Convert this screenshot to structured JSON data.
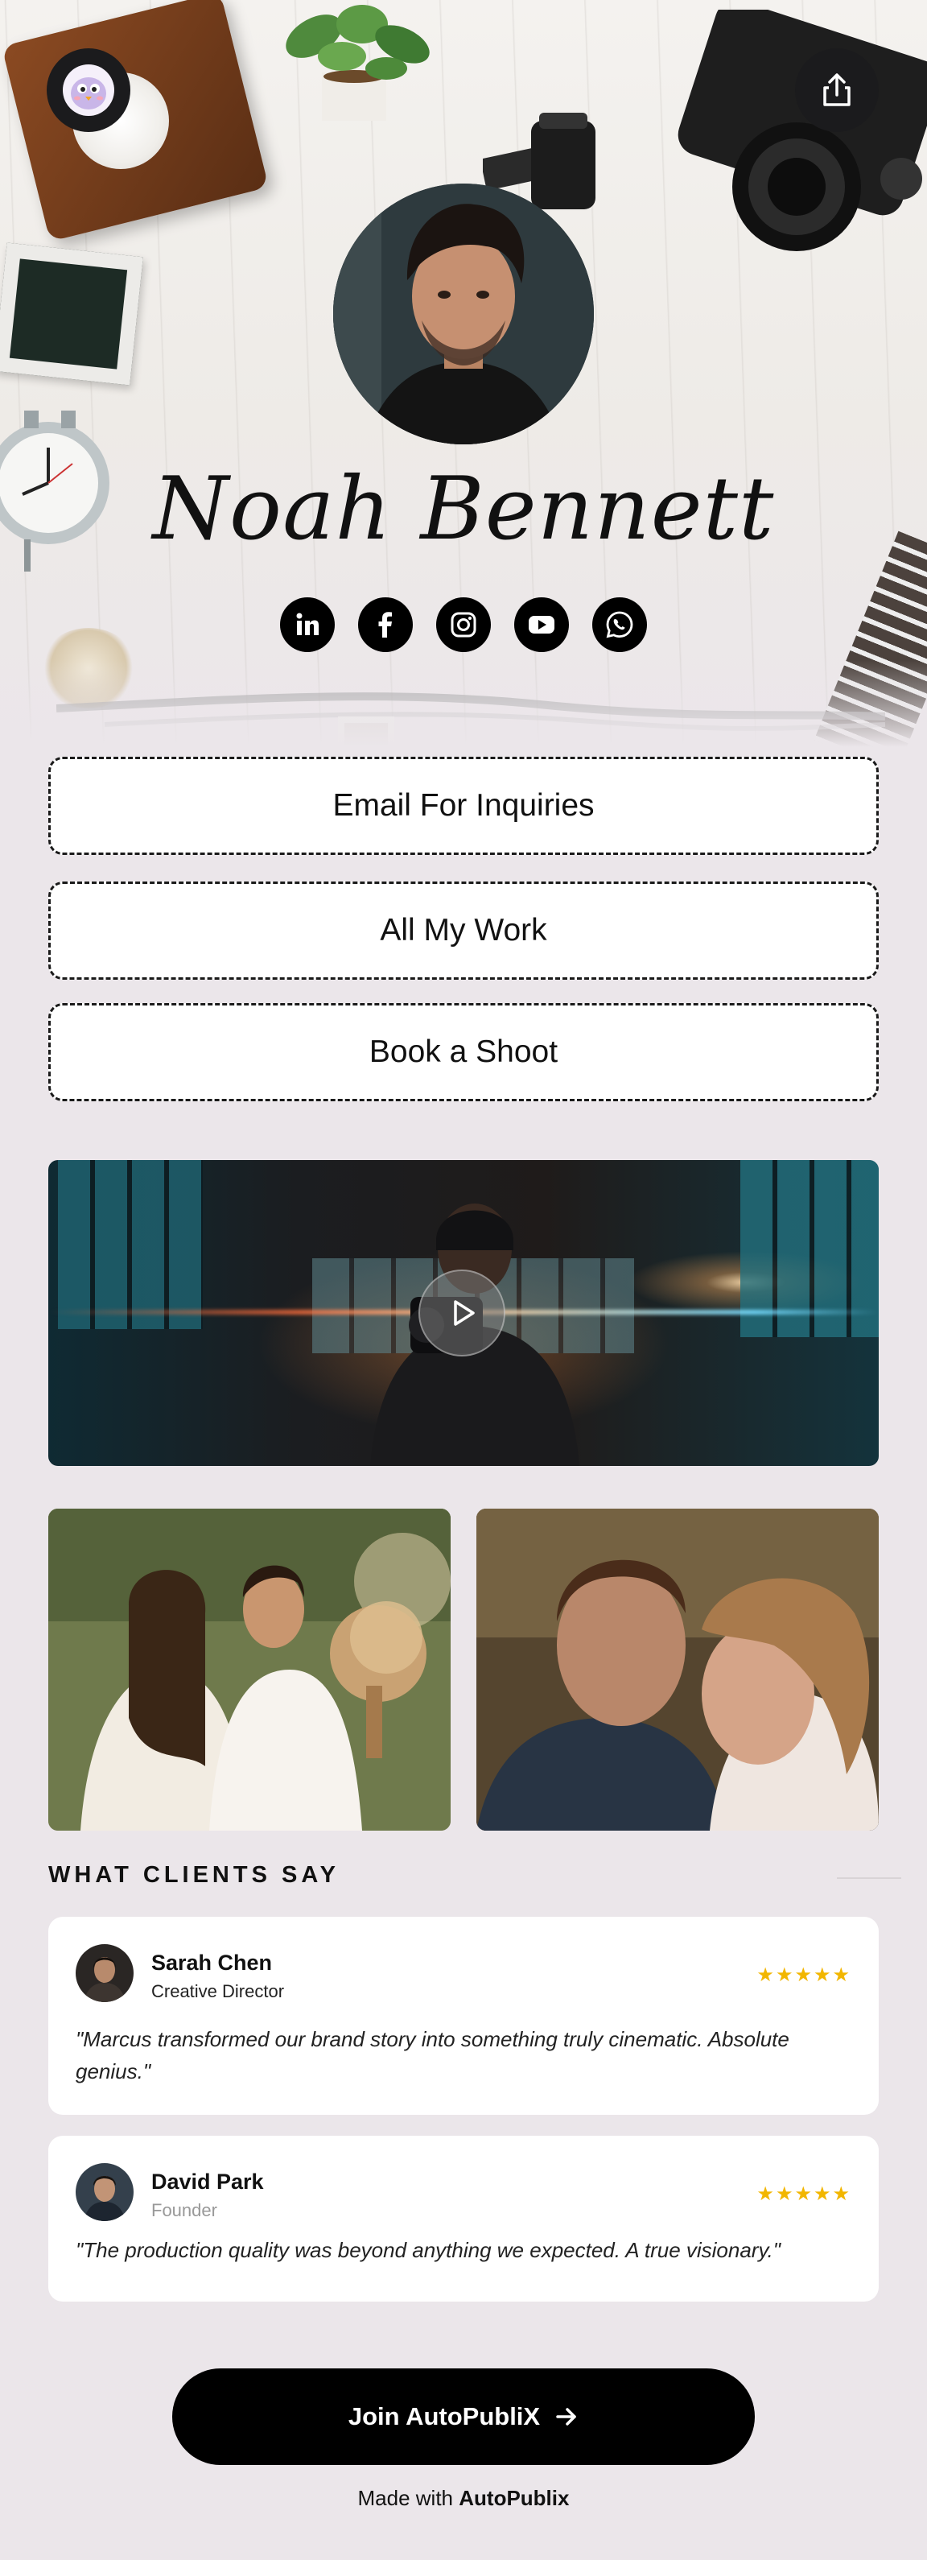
{
  "profile": {
    "name": "Noah Bennett",
    "socials": [
      {
        "icon": "linkedin-icon",
        "label": "in"
      },
      {
        "icon": "facebook-icon",
        "label": "f"
      },
      {
        "icon": "instagram-icon",
        "label": ""
      },
      {
        "icon": "youtube-icon",
        "label": ""
      },
      {
        "icon": "whatsapp-icon",
        "label": ""
      }
    ]
  },
  "links": {
    "email": "Email For Inquiries",
    "work": "All My Work",
    "book": "Book a Shoot"
  },
  "testimonials": {
    "title": "WHAT CLIENTS SAY",
    "items": [
      {
        "name": "Sarah Chen",
        "role": "Creative Director",
        "stars": "★★★★★",
        "quote": "\"Marcus transformed our brand story into something truly cinematic. Absolute genius.\""
      },
      {
        "name": "David Park",
        "role": "Founder",
        "stars": "★★★★★",
        "quote": "\"The production quality was beyond anything we expected. A true visionary.\""
      }
    ]
  },
  "footer": {
    "join_label": "Join AutoPubliX",
    "made_with_prefix": "Made with",
    "made_with_brand": "AutoPublix"
  },
  "colors": {
    "background": "#ebe6ea",
    "button_dark": "#000000",
    "star": "#f2b600"
  }
}
